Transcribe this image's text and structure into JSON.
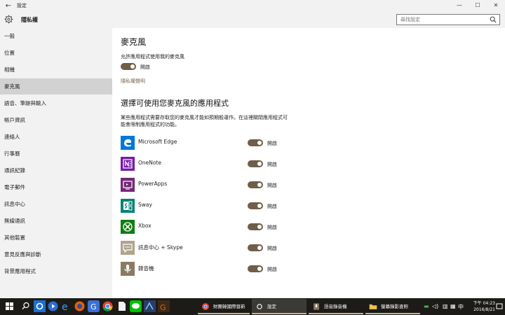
{
  "window": {
    "title": "設定",
    "back_glyph": "←",
    "minimize": "—",
    "maximize": "☐",
    "close": "✕"
  },
  "header": {
    "title": "隱私權",
    "search_placeholder": "尋找設定"
  },
  "sidebar": {
    "items": [
      {
        "label": "一般"
      },
      {
        "label": "位置"
      },
      {
        "label": "相機"
      },
      {
        "label": "麥克風",
        "active": true
      },
      {
        "label": "語音、筆跡與輸入"
      },
      {
        "label": "帳戶資訊"
      },
      {
        "label": "連絡人"
      },
      {
        "label": "行事曆"
      },
      {
        "label": "通訊紀錄"
      },
      {
        "label": "電子郵件"
      },
      {
        "label": "訊息中心"
      },
      {
        "label": "無線通訊"
      },
      {
        "label": "其他裝置"
      },
      {
        "label": "意見反應與診斷"
      },
      {
        "label": "背景應用程式"
      }
    ]
  },
  "main": {
    "heading": "麥克風",
    "allow_text": "允許應用程式使用我的麥克風",
    "master_toggle_label": "開啟",
    "privacy_link": "隱私權聲明",
    "section_heading": "選擇可使用您麥克風的應用程式",
    "section_desc": "某些應用程式需要存取您的麥克風才能如預期般運作。在這裡關閉應用程式可能會限制應用程式的功能。",
    "apps": [
      {
        "name": "Microsoft Edge",
        "icon": "edge-icon",
        "color": "#0078d7",
        "toggle_label": "開啟"
      },
      {
        "name": "OneNote",
        "icon": "onenote-icon",
        "color": "#7719aa",
        "toggle_label": "開啟"
      },
      {
        "name": "PowerApps",
        "icon": "powerapps-icon",
        "color": "#742774",
        "toggle_label": "開啟"
      },
      {
        "name": "Sway",
        "icon": "sway-icon",
        "color": "#008272",
        "toggle_label": "開啟"
      },
      {
        "name": "Xbox",
        "icon": "xbox-icon",
        "color": "#107c10",
        "toggle_label": "開啟"
      },
      {
        "name": "訊息中心 + Skype",
        "icon": "messaging-icon",
        "color": "#b0a48f",
        "toggle_label": "開啟"
      },
      {
        "name": "錄音機",
        "icon": "voice-recorder-icon",
        "color": "#8a7b65",
        "toggle_label": "開啟"
      }
    ]
  },
  "taskbar": {
    "tasks": [
      {
        "label": "財團韓國際發新主...",
        "icon": "chrome-icon"
      },
      {
        "label": "設定",
        "icon": "gear-icon",
        "active": true
      },
      {
        "label": "語音錄音機",
        "icon": "voice-recorder-icon"
      },
      {
        "label": "螢幕錄影查照",
        "icon": "folder-icon"
      }
    ],
    "clock_time": "下午 04:23",
    "clock_date": "2016/8/21"
  },
  "colors": {
    "accent": "#6f5e48",
    "sidebar_bg": "#f2f2f2",
    "active_item": "#d2d2d2",
    "taskbar": "#1d1b17"
  }
}
